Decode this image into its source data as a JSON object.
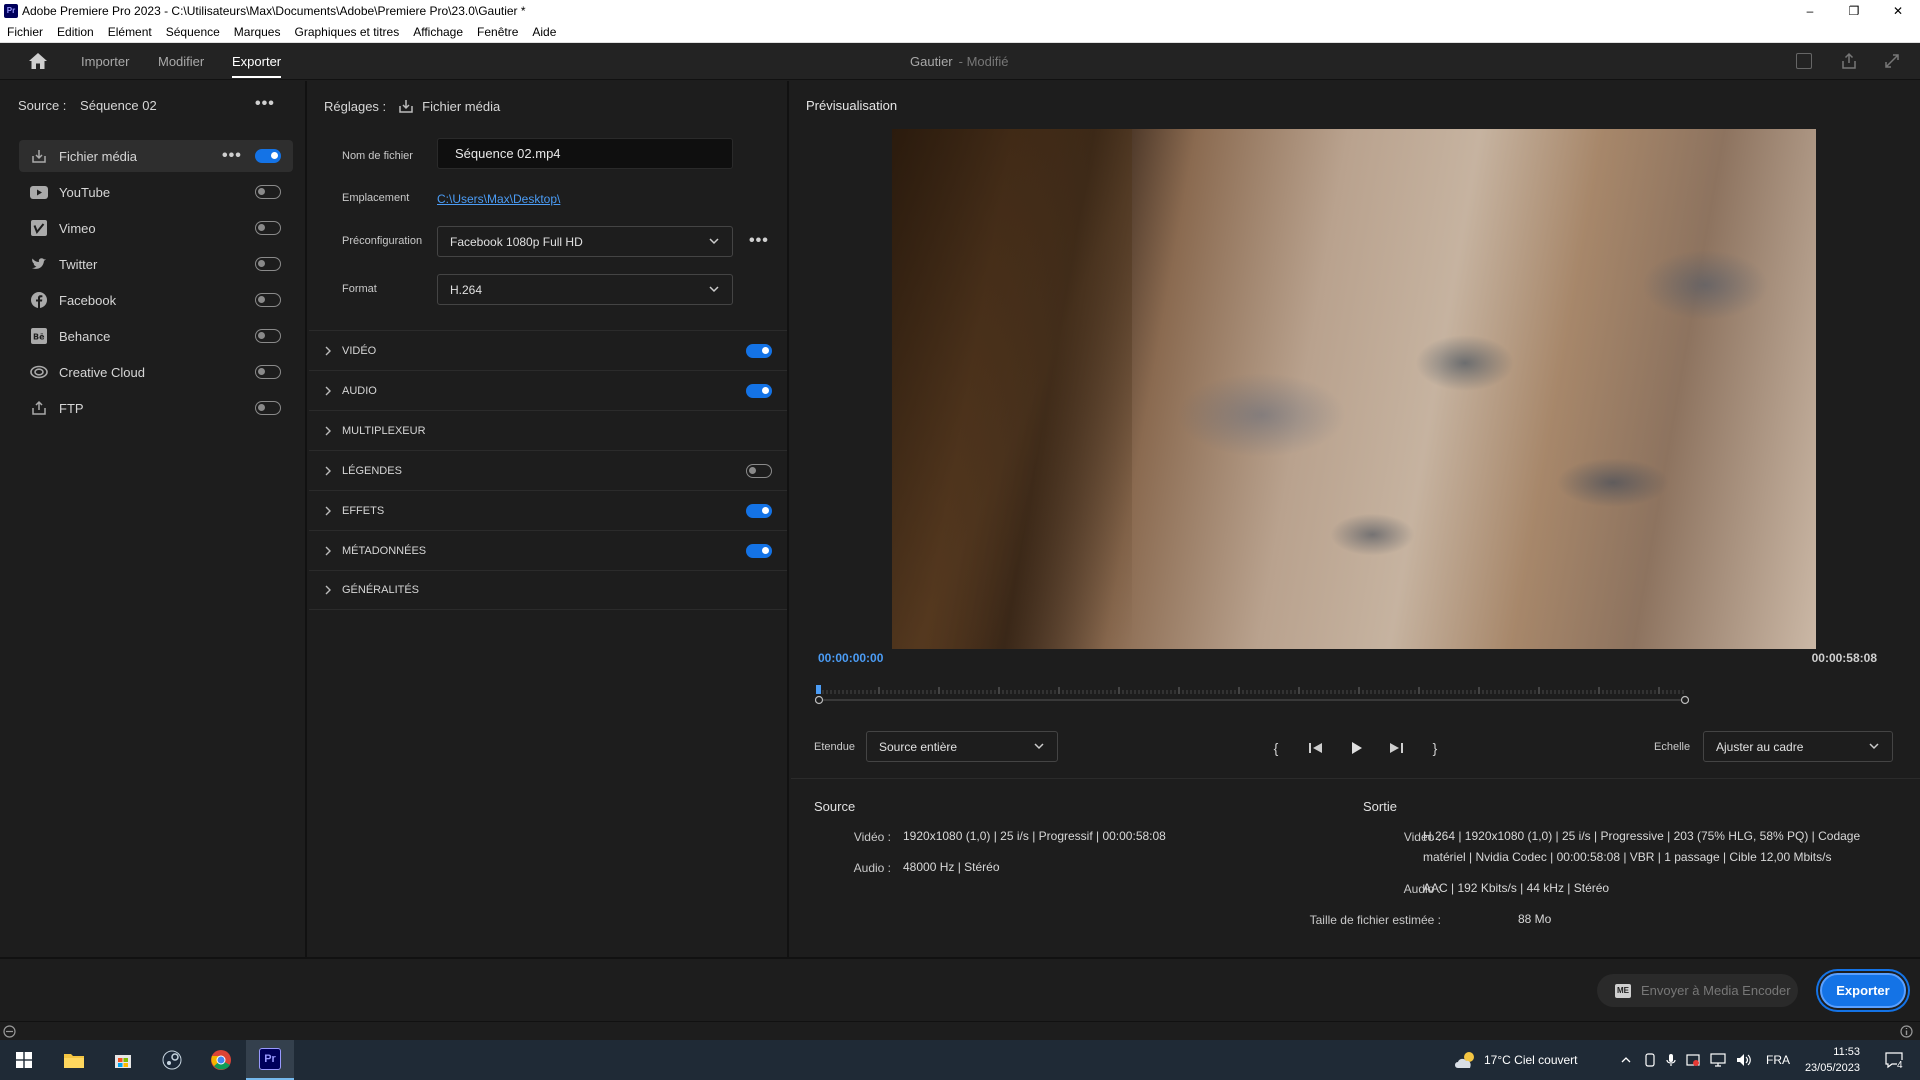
{
  "titlebar": {
    "app_icon_text": "Pr",
    "title": "Adobe Premiere Pro 2023 - C:\\Utilisateurs\\Max\\Documents\\Adobe\\Premiere Pro\\23.0\\Gautier *",
    "min_icon": "minimize-icon",
    "restore_icon": "restore-icon",
    "close_icon": "close-icon"
  },
  "menu": [
    "Fichier",
    "Edition",
    "Elément",
    "Séquence",
    "Marques",
    "Graphiques et titres",
    "Affichage",
    "Fenêtre",
    "Aide"
  ],
  "header": {
    "tabs": [
      {
        "label": "Importer",
        "active": false
      },
      {
        "label": "Modifier",
        "active": false
      },
      {
        "label": "Exporter",
        "active": true
      }
    ],
    "project_name": "Gautier",
    "project_state": "- Modifié"
  },
  "source": {
    "label": "Source :",
    "value": "Séquence 02"
  },
  "destinations": [
    {
      "name": "Fichier média",
      "icon": "export-file-icon",
      "on": true,
      "selected": true
    },
    {
      "name": "YouTube",
      "icon": "youtube-icon",
      "on": false
    },
    {
      "name": "Vimeo",
      "icon": "vimeo-icon",
      "on": false
    },
    {
      "name": "Twitter",
      "icon": "twitter-icon",
      "on": false
    },
    {
      "name": "Facebook",
      "icon": "facebook-icon",
      "on": false
    },
    {
      "name": "Behance",
      "icon": "behance-icon",
      "on": false
    },
    {
      "name": "Creative Cloud",
      "icon": "creative-cloud-icon",
      "on": false
    },
    {
      "name": "FTP",
      "icon": "ftp-icon",
      "on": false
    }
  ],
  "settings": {
    "label": "Réglages :",
    "target": "Fichier média",
    "filename_label": "Nom de fichier",
    "filename": "Séquence 02.mp4",
    "location_label": "Emplacement",
    "location": "C:\\Users\\Max\\Desktop\\",
    "preset_label": "Préconfiguration",
    "preset": "Facebook 1080p Full HD",
    "format_label": "Format",
    "format": "H.264",
    "sections": [
      {
        "name": "VIDÉO",
        "toggle": true,
        "on": true
      },
      {
        "name": "AUDIO",
        "toggle": true,
        "on": true
      },
      {
        "name": "MULTIPLEXEUR",
        "toggle": false
      },
      {
        "name": "LÉGENDES",
        "toggle": true,
        "on": false
      },
      {
        "name": "EFFETS",
        "toggle": true,
        "on": true
      },
      {
        "name": "MÉTADONNÉES",
        "toggle": true,
        "on": true
      },
      {
        "name": "GÉNÉRALITÉS",
        "toggle": false
      }
    ]
  },
  "preview": {
    "title": "Prévisualisation",
    "tc_start": "00:00:00:00",
    "tc_end": "00:00:58:08",
    "playhead_fraction": 0.0,
    "range_label": "Etendue",
    "range_value": "Source entière",
    "scale_label": "Echelle",
    "scale_value": "Ajuster au cadre"
  },
  "info": {
    "source_title": "Source",
    "source_video_label": "Vidéo :",
    "source_video": "1920x1080 (1,0)  |  25 i/s  |  Progressif  |  00:00:58:08",
    "source_audio_label": "Audio :",
    "source_audio": "48000 Hz  |  Stéréo",
    "output_title": "Sortie",
    "output_video_label": "Vidéo :",
    "output_video_line1": "H.264  |  1920x1080 (1,0)  |  25 i/s  |  Progressive  |  203 (75% HLG, 58% PQ)  |  Codage",
    "output_video_line2": "matériel  |  Nvidia Codec  |  00:00:58:08  |  VBR  |  1 passage  |  Cible 12,00 Mbits/s",
    "output_audio_label": "Audio :",
    "output_audio": "AAC  |  192 Kbits/s  |  44 kHz  |  Stéréo",
    "size_label": "Taille de fichier estimée :",
    "size_value": "88 Mo"
  },
  "footer": {
    "ame_icon": "ME",
    "ame_label": "Envoyer à Media Encoder",
    "export_label": "Exporter"
  },
  "taskbar": {
    "weather": "17°C  Ciel couvert",
    "lang": "FRA",
    "time": "11:53",
    "date": "23/05/2023",
    "notif_count": "4",
    "premiere_label": "Pr"
  },
  "colors": {
    "accent": "#1473e6",
    "link": "#4b9cf5",
    "panel": "#1d1d1d"
  }
}
